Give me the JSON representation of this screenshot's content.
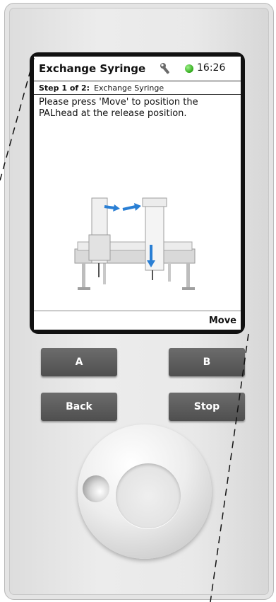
{
  "screen": {
    "title": "Exchange Syringe",
    "time": "16:26",
    "status_color": "#3fbf2a",
    "step": {
      "label": "Step 1 of 2:",
      "name": "Exchange Syringe"
    },
    "instruction": "Please press 'Move' to position the PALhead at the release position.",
    "action": "Move"
  },
  "buttons": {
    "a": "A",
    "b": "B",
    "back": "Back",
    "stop": "Stop"
  },
  "icons": {
    "service": "wrench-icon",
    "status": "status-indicator-icon",
    "illustration": "robot-arm-illustration",
    "knob": "rotary-knob"
  },
  "colors": {
    "button_bg": "#5a5a5a",
    "arrow_blue": "#2a7fd4",
    "bezel": "#111111"
  }
}
